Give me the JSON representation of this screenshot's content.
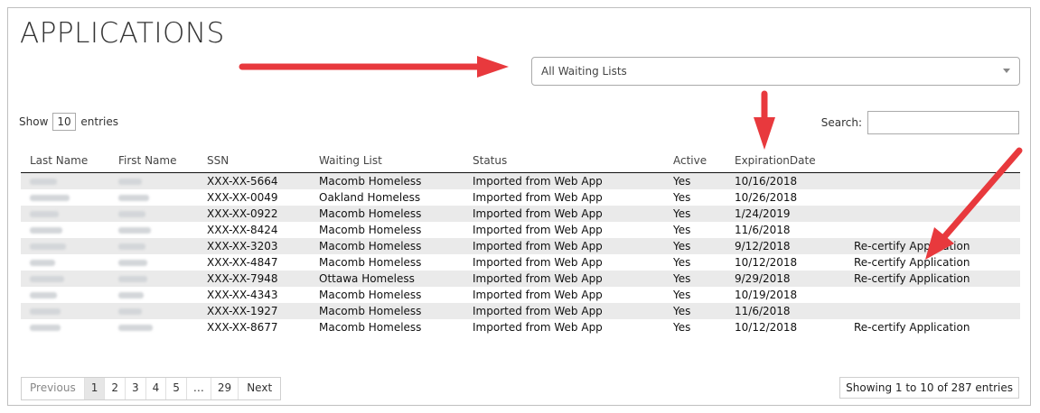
{
  "page": {
    "title": "APPLICATIONS"
  },
  "filter": {
    "waiting_list_selected": "All Waiting Lists"
  },
  "table_controls": {
    "show_label": "Show",
    "page_length": "10",
    "entries_label": "entries",
    "search_label": "Search:",
    "search_value": ""
  },
  "table": {
    "columns": [
      "Last Name",
      "First Name",
      "SSN",
      "Waiting List",
      "Status",
      "Active",
      "ExpirationDate",
      ""
    ],
    "rows": [
      {
        "ssn": "XXX-XX-5664",
        "waiting_list": "Macomb Homeless",
        "status": "Imported from Web App",
        "active": "Yes",
        "expiration": "10/16/2018",
        "action": ""
      },
      {
        "ssn": "XXX-XX-0049",
        "waiting_list": "Oakland Homeless",
        "status": "Imported from Web App",
        "active": "Yes",
        "expiration": "10/26/2018",
        "action": ""
      },
      {
        "ssn": "XXX-XX-0922",
        "waiting_list": "Macomb Homeless",
        "status": "Imported from Web App",
        "active": "Yes",
        "expiration": "1/24/2019",
        "action": ""
      },
      {
        "ssn": "XXX-XX-8424",
        "waiting_list": "Macomb Homeless",
        "status": "Imported from Web App",
        "active": "Yes",
        "expiration": "11/6/2018",
        "action": ""
      },
      {
        "ssn": "XXX-XX-3203",
        "waiting_list": "Macomb Homeless",
        "status": "Imported from Web App",
        "active": "Yes",
        "expiration": "9/12/2018",
        "action": "Re-certify Application"
      },
      {
        "ssn": "XXX-XX-4847",
        "waiting_list": "Macomb Homeless",
        "status": "Imported from Web App",
        "active": "Yes",
        "expiration": "10/12/2018",
        "action": "Re-certify Application"
      },
      {
        "ssn": "XXX-XX-7948",
        "waiting_list": "Ottawa Homeless",
        "status": "Imported from Web App",
        "active": "Yes",
        "expiration": "9/29/2018",
        "action": "Re-certify Application"
      },
      {
        "ssn": "XXX-XX-4343",
        "waiting_list": "Macomb Homeless",
        "status": "Imported from Web App",
        "active": "Yes",
        "expiration": "10/19/2018",
        "action": ""
      },
      {
        "ssn": "XXX-XX-1927",
        "waiting_list": "Macomb Homeless",
        "status": "Imported from Web App",
        "active": "Yes",
        "expiration": "11/6/2018",
        "action": ""
      },
      {
        "ssn": "XXX-XX-8677",
        "waiting_list": "Macomb Homeless",
        "status": "Imported from Web App",
        "active": "Yes",
        "expiration": "10/12/2018",
        "action": "Re-certify Application"
      }
    ]
  },
  "pagination": {
    "previous": "Previous",
    "pages": [
      "1",
      "2",
      "3",
      "4",
      "5",
      "…",
      "29"
    ],
    "current": "1",
    "next": "Next",
    "info": "Showing 1 to 10 of 287 entries"
  },
  "colors": {
    "annotation_arrow": "#e8393d",
    "link": "#3a7cc4",
    "striped_row": "#eaeaea"
  }
}
